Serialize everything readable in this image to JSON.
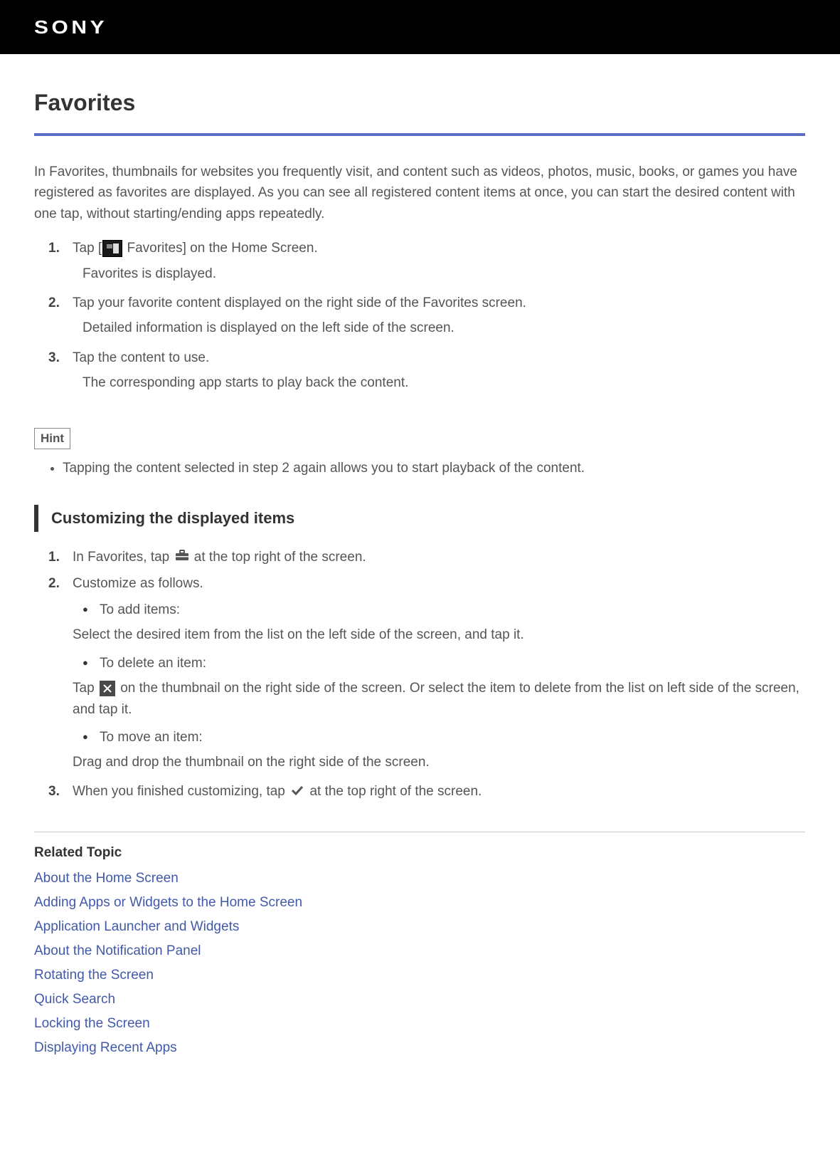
{
  "brand": "SONY",
  "title": "Favorites",
  "intro": "In Favorites, thumbnails for websites you frequently visit, and content such as videos, photos, music, books, or games you have registered as favorites are displayed. As you can see all registered content items at once, you can start the desired content with one tap, without starting/ending apps repeatedly.",
  "steps": {
    "s1_pre": "Tap [",
    "s1_post": " Favorites] on the Home Screen.",
    "s1_sub": "Favorites is displayed.",
    "s2": "Tap your favorite content displayed on the right side of the Favorites screen.",
    "s2_sub": "Detailed information is displayed on the left side of the screen.",
    "s3": "Tap the content to use.",
    "s3_sub": "The corresponding app starts to play back the content."
  },
  "hint_label": "Hint",
  "hint_text": "Tapping the content selected in step 2 again allows you to start playback of the content.",
  "customizing_heading": "Customizing the displayed items",
  "customize": {
    "c1_pre": "In Favorites, tap ",
    "c1_post": " at the top right of the screen.",
    "c2": "Customize as follows.",
    "add_label": "To add items:",
    "add_detail": "Select the desired item from the list on the left side of the screen, and tap it.",
    "delete_label": "To delete an item:",
    "delete_pre": "Tap ",
    "delete_post": " on the thumbnail on the right side of the screen. Or select the item to delete from the list on left side of the screen, and tap it.",
    "move_label": "To move an item:",
    "move_detail": "Drag and drop the thumbnail on the right side of the screen.",
    "c3_pre": "When you finished customizing, tap ",
    "c3_post": " at the top right of the screen."
  },
  "related_heading": "Related Topic",
  "related_links": [
    "About the Home Screen",
    "Adding Apps or Widgets to the Home Screen",
    "Application Launcher and Widgets",
    "About the Notification Panel",
    "Rotating the Screen",
    "Quick Search",
    "Locking the Screen",
    "Displaying Recent Apps"
  ]
}
